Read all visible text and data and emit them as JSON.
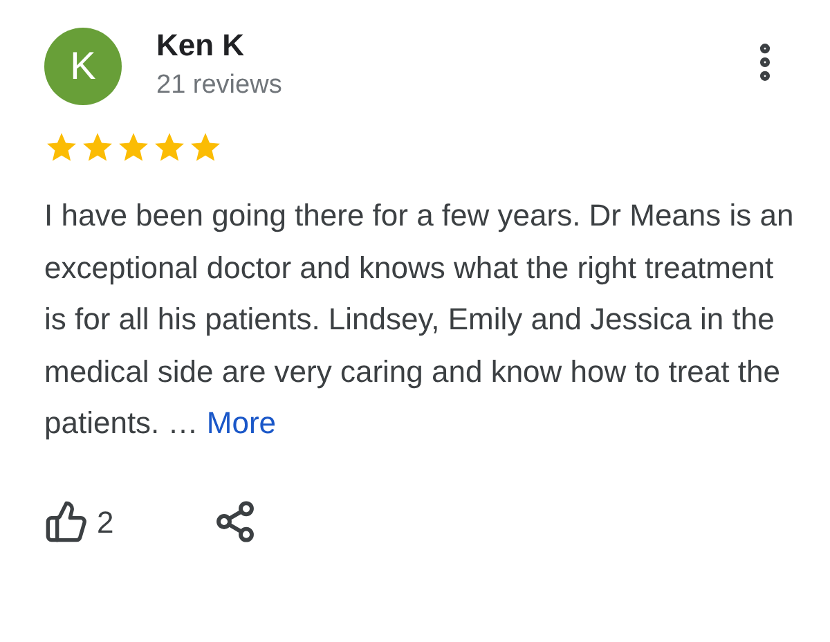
{
  "reviewer": {
    "initial": "K",
    "name": "Ken K",
    "reviews": "21 reviews"
  },
  "rating": {
    "stars": 5
  },
  "review": {
    "text": "I have been going there for a few years. Dr Means is an exceptional doctor and knows what the right treatment is for all his patients. Lindsey, Emily and Jessica in the medical side are very caring and know how to treat the patients. …",
    "more": "More"
  },
  "actions": {
    "likes": "2"
  }
}
